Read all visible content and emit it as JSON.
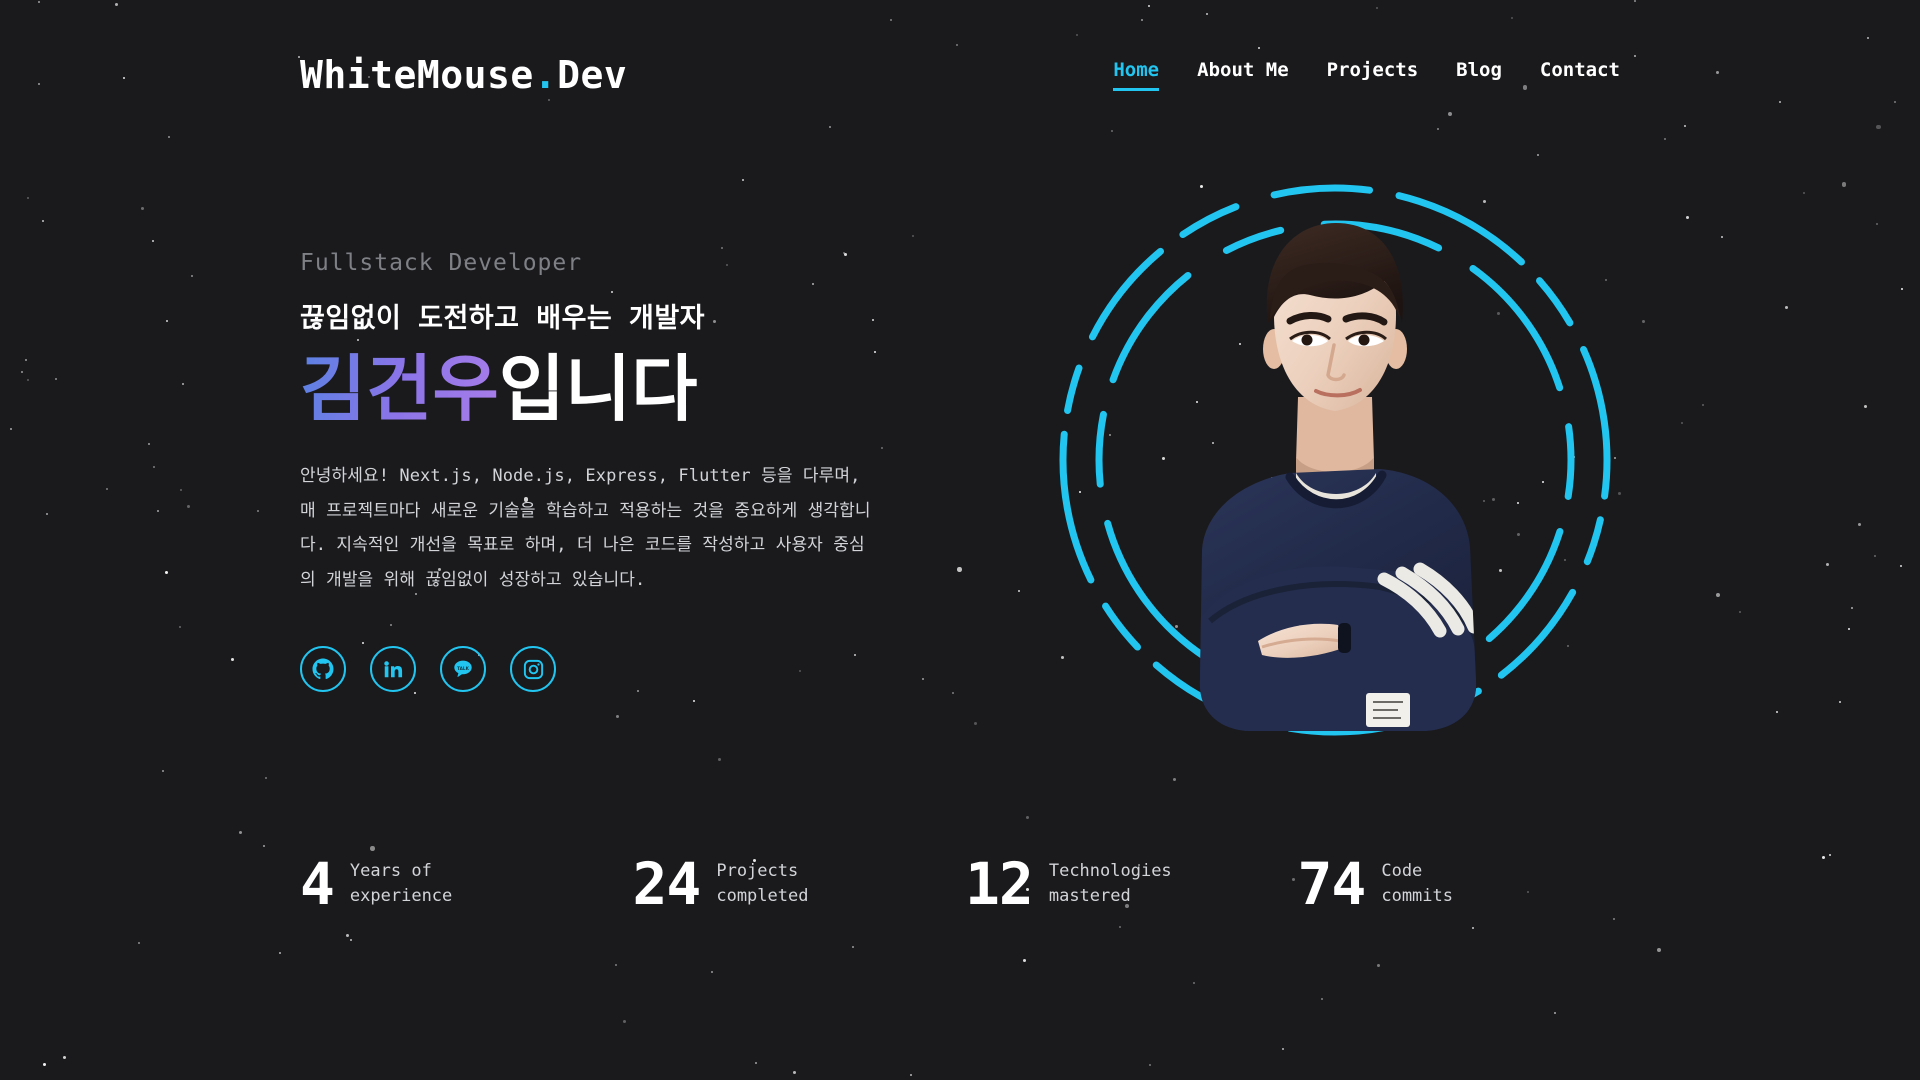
{
  "site": {
    "logo_text": "WhiteMouse",
    "logo_dot": ".",
    "logo_suffix": "Dev",
    "accent_cyan": "#22c5f0",
    "background": "#1a1a1d",
    "gradient_start": "#5b82e3",
    "gradient_end": "#a87de9"
  },
  "nav": {
    "items": [
      {
        "label": "Home",
        "active": true
      },
      {
        "label": "About Me",
        "active": false
      },
      {
        "label": "Projects",
        "active": false
      },
      {
        "label": "Blog",
        "active": false
      },
      {
        "label": "Contact",
        "active": false
      }
    ]
  },
  "hero": {
    "eyebrow": "Fullstack Developer",
    "headline": "끊임없이 도전하고 배우는 개발자",
    "name_gradient": "김건우",
    "name_plain": "입니다",
    "about": "안녕하세요! Next.js, Node.js, Express, Flutter 등을 다루며, 매 프로젝트마다 새로운 기술을 학습하고 적용하는 것을 중요하게 생각합니다. 지속적인 개선을 목표로 하며, 더 나은 코드를 작성하고 사용자 중심의 개발을 위해 끊임없이 성장하고 있습니다."
  },
  "socials": [
    {
      "name": "github-icon",
      "label": "GitHub"
    },
    {
      "name": "linkedin-icon",
      "label": "LinkedIn"
    },
    {
      "name": "kakaotalk-icon",
      "label": "KakaoTalk"
    },
    {
      "name": "instagram-icon",
      "label": "Instagram"
    }
  ],
  "portrait": {
    "alt": "Profile photo of developer with arms crossed"
  },
  "stats": [
    {
      "value": "4",
      "label": "Years of\nexperience"
    },
    {
      "value": "24",
      "label": "Projects\ncompleted"
    },
    {
      "value": "12",
      "label": "Technologies\nmastered"
    },
    {
      "value": "74",
      "label": "Code\ncommits"
    }
  ]
}
